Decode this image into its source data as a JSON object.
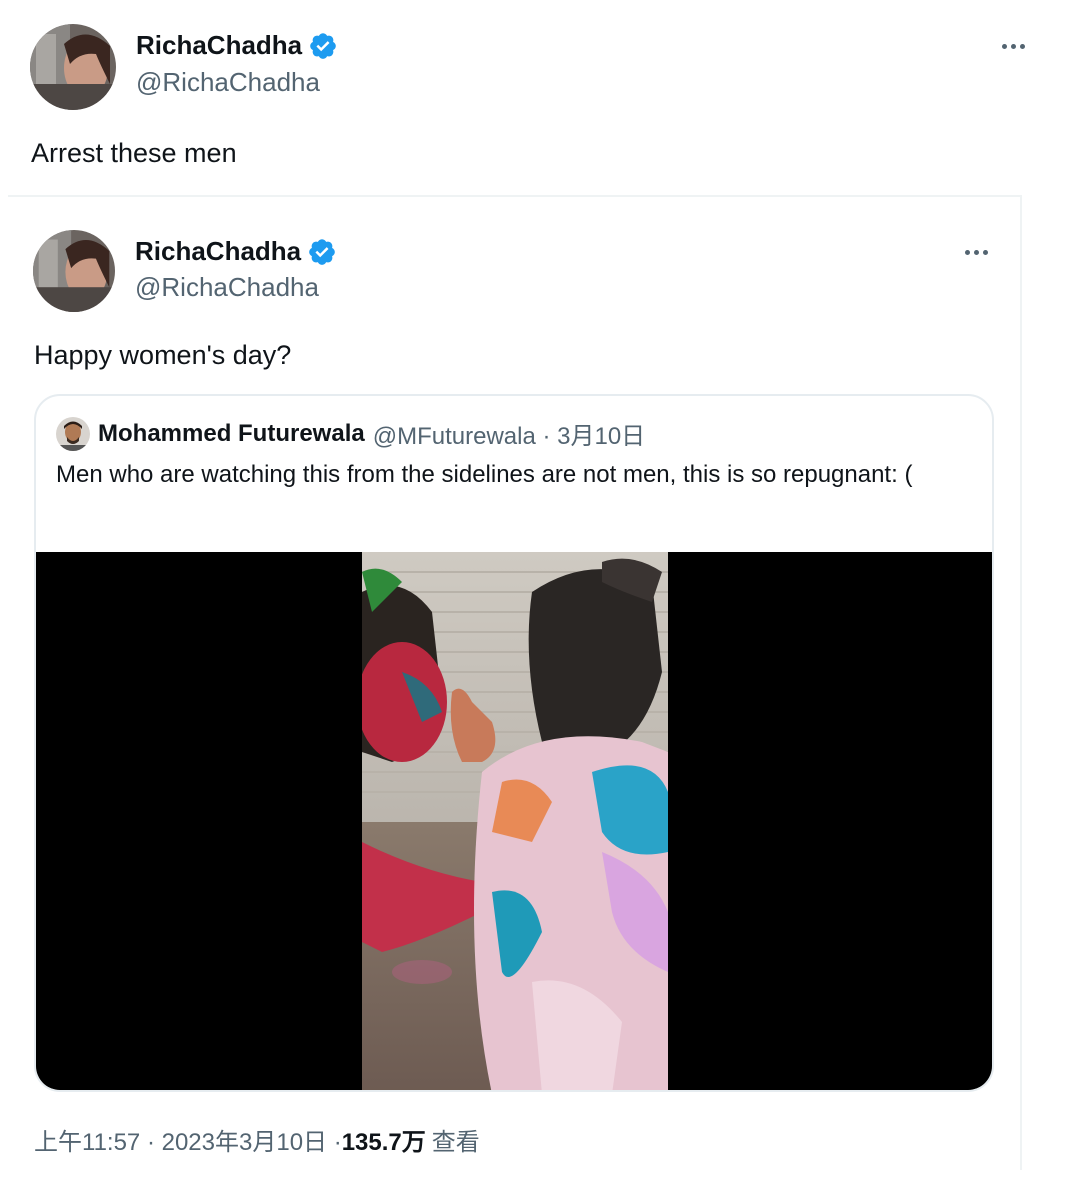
{
  "outer_tweet": {
    "display_name": "RichaChadha",
    "handle": "@RichaChadha",
    "text": "Arrest these men",
    "avatar_icon": "avatar-photo-icon"
  },
  "quoted_tweet": {
    "display_name": "RichaChadha",
    "handle": "@RichaChadha",
    "text": "Happy women's day?"
  },
  "nested_quote": {
    "display_name": "Mohammed Futurewala",
    "handle_date": "@MFuturewala · 3月10日",
    "text": "Men who are watching this from the sidelines are not men, this is so repugnant: ("
  },
  "meta": {
    "time_date": "上午11:57 · 2023年3月10日 · ",
    "views_count": "135.7万",
    "views_label": "查看"
  },
  "colors": {
    "verified": "#1d9bf0",
    "secondary_text": "#536471",
    "primary_text": "#0f1419"
  }
}
